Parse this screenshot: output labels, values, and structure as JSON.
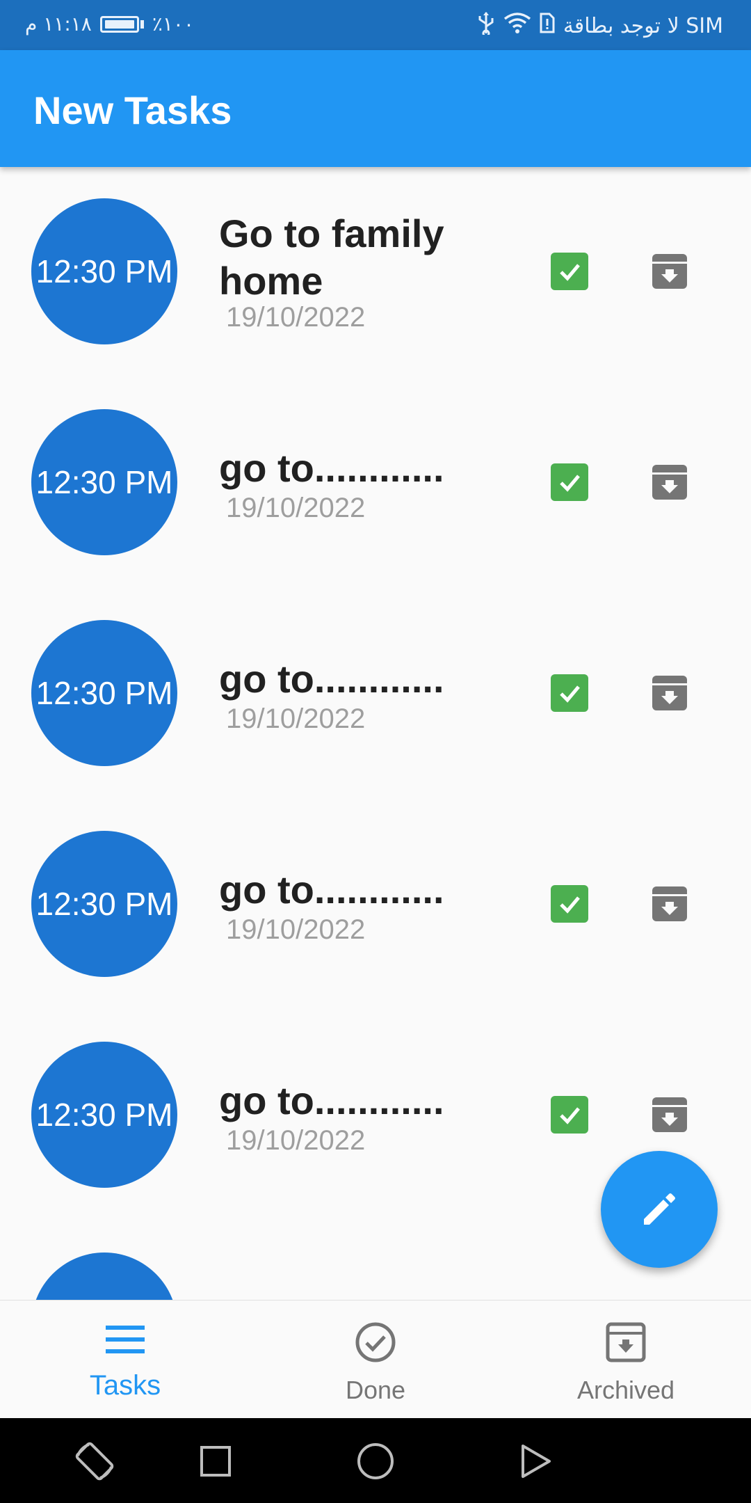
{
  "status_bar": {
    "time": "١١:١٨ م",
    "battery": "٪١٠٠",
    "carrier": "لا توجد بطاقة SIM"
  },
  "app_bar": {
    "title": "New Tasks"
  },
  "tasks": [
    {
      "time": "12:30 PM",
      "title": "Go to family home",
      "date": "19/10/2022"
    },
    {
      "time": "12:30 PM",
      "title": "go to............",
      "date": "19/10/2022"
    },
    {
      "time": "12:30 PM",
      "title": "go to............",
      "date": "19/10/2022"
    },
    {
      "time": "12:30 PM",
      "title": "go to............",
      "date": "19/10/2022"
    },
    {
      "time": "12:30 PM",
      "title": "go to............",
      "date": "19/10/2022"
    }
  ],
  "fab": {
    "icon": "edit-icon"
  },
  "bottom_nav": {
    "items": [
      {
        "label": "Tasks",
        "icon": "menu-icon",
        "active": true
      },
      {
        "label": "Done",
        "icon": "check-circle-icon",
        "active": false
      },
      {
        "label": "Archived",
        "icon": "archive-icon",
        "active": false
      }
    ]
  },
  "colors": {
    "primary": "#2196f3",
    "circle": "#1d76d2",
    "status_bar": "#1c6fbd",
    "done_check": "#4caf50",
    "archive_grey": "#757575"
  }
}
